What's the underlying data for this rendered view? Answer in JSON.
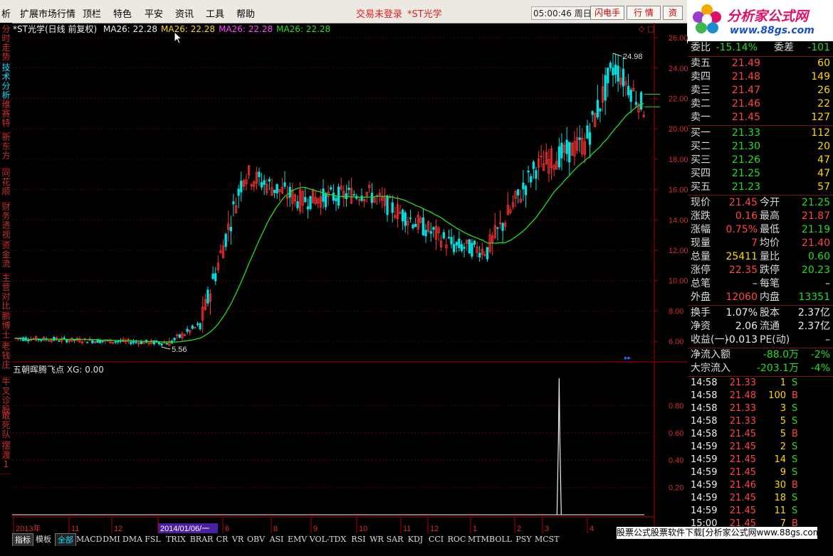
{
  "menu": {
    "items": [
      "析",
      "扩展市场行情",
      "顶栏",
      "特色",
      "平安",
      "资讯",
      "工具",
      "帮助"
    ],
    "login_status": "交易未登录",
    "stock_name": "*ST光学",
    "clock": "05:00:46 周日",
    "buttons": [
      "闪电手",
      "行 情",
      "资"
    ]
  },
  "logo": {
    "title": "分析家公式网",
    "url": "www.88gs.com"
  },
  "left_tabs": [
    {
      "label": "分时走势",
      "active": false
    },
    {
      "label": "技术分析",
      "active": true
    },
    {
      "label": "维赛特",
      "active": false
    },
    {
      "label": "新东方",
      "active": false
    },
    {
      "label": "同花顺",
      "active": false
    },
    {
      "label": "财务透视",
      "active": false
    },
    {
      "label": "资金流",
      "active": false
    },
    {
      "label": "主营对比",
      "active": false
    },
    {
      "label": "鹏博士",
      "active": false
    },
    {
      "label": "老钱庄",
      "active": false
    },
    {
      "label": "牛叉诊股",
      "active": false
    },
    {
      "label": "敢死队",
      "active": false
    },
    {
      "label": "摆渡1",
      "active": false
    }
  ],
  "chart_header": {
    "title": "*ST光学(日线 前复权)",
    "ma_items": [
      {
        "text": "MA26: 22.28",
        "color": "#eeeeee"
      },
      {
        "text": "MA26: 22.28",
        "color": "#ffd700"
      },
      {
        "text": "MA26: 22.28",
        "color": "#ff44ff"
      },
      {
        "text": "MA26: 22.28",
        "color": "#22dd22"
      }
    ]
  },
  "indicator_header": {
    "name": "五朝晖腾飞点",
    "value": "XG: 0.00"
  },
  "chart_data": [
    {
      "type": "candlestick",
      "title": "*ST光学(日线 前复权)",
      "y_ticks": [
        "26.00",
        "24.00",
        "22.00",
        "20.00",
        "18.00",
        "16.00",
        "14.00",
        "12.00",
        "10.00",
        "8.00",
        "6.00"
      ],
      "ylim": [
        4.6,
        26.8
      ],
      "annotations": [
        {
          "text": "24.98",
          "x": "high"
        },
        {
          "text": "5.56",
          "x": "low"
        }
      ],
      "phases": [
        {
          "bars": 60,
          "from": 6.2,
          "to": 5.9,
          "vol": 0.2
        },
        {
          "bars": 12,
          "from": 5.9,
          "to": 7.0,
          "vol": 0.3
        },
        {
          "bars": 18,
          "from": 7.0,
          "to": 17.0,
          "vol": 1.0
        },
        {
          "bars": 22,
          "from": 17.0,
          "to": 15.3,
          "vol": 0.9
        },
        {
          "bars": 25,
          "from": 15.3,
          "to": 15.8,
          "vol": 0.8
        },
        {
          "bars": 35,
          "from": 15.8,
          "to": 12.3,
          "vol": 0.8
        },
        {
          "bars": 12,
          "from": 12.3,
          "to": 12.0,
          "vol": 0.7
        },
        {
          "bars": 20,
          "from": 12.0,
          "to": 17.5,
          "vol": 1.0
        },
        {
          "bars": 18,
          "from": 17.5,
          "to": 19.0,
          "vol": 1.0
        },
        {
          "bars": 12,
          "from": 19.0,
          "to": 24.0,
          "vol": 1.2
        },
        {
          "bars": 12,
          "from": 24.0,
          "to": 21.4,
          "vol": 1.0
        }
      ],
      "ma_period": 26,
      "ma_last": 22.28,
      "last_close": 21.45
    },
    {
      "type": "bar",
      "title": "五朝晖腾飞点",
      "y_ticks": [
        "0.80",
        "0.60",
        "0.40",
        "0.20"
      ],
      "ylim": [
        0,
        1.0
      ],
      "signal": {
        "name": "XG",
        "value": 1.0,
        "bar_index": 212
      }
    }
  ],
  "x_axis": {
    "labels": [
      "2013年",
      "11",
      "12",
      "2014/01/06/一",
      "6",
      "8",
      "9",
      "10",
      "11",
      "12",
      "1",
      "2",
      "3",
      "4"
    ],
    "selected": "2014/01/06/一"
  },
  "quote": {
    "weibi": {
      "label": "委比",
      "value": "-15.14%",
      "label2": "委差",
      "value2": "-101"
    },
    "sell": [
      {
        "label": "卖五",
        "price": "21.49",
        "vol": "60"
      },
      {
        "label": "卖四",
        "price": "21.48",
        "vol": "149"
      },
      {
        "label": "卖三",
        "price": "21.47",
        "vol": "26"
      },
      {
        "label": "卖二",
        "price": "21.46",
        "vol": "22"
      },
      {
        "label": "卖一",
        "price": "21.45",
        "vol": "127"
      }
    ],
    "buy": [
      {
        "label": "买一",
        "price": "21.33",
        "vol": "112"
      },
      {
        "label": "买二",
        "price": "21.30",
        "vol": "20"
      },
      {
        "label": "买三",
        "price": "21.26",
        "vol": "47"
      },
      {
        "label": "买四",
        "price": "21.25",
        "vol": "47"
      },
      {
        "label": "买五",
        "price": "21.23",
        "vol": "57"
      }
    ],
    "stats": [
      {
        "l1": "现价",
        "v1": "21.45",
        "c1": "red",
        "l2": "今开",
        "v2": "21.25",
        "c2": "green"
      },
      {
        "l1": "涨跌",
        "v1": "0.16",
        "c1": "red",
        "l2": "最高",
        "v2": "21.87",
        "c2": "red"
      },
      {
        "l1": "涨幅",
        "v1": "0.75%",
        "c1": "red",
        "l2": "最低",
        "v2": "21.19",
        "c2": "green"
      },
      {
        "l1": "现量",
        "v1": "7",
        "c1": "red",
        "l2": "均价",
        "v2": "21.40",
        "c2": "red"
      },
      {
        "l1": "总量",
        "v1": "25411",
        "c1": "yellow",
        "l2": "量比",
        "v2": "0.60",
        "c2": "green"
      },
      {
        "l1": "涨停",
        "v1": "22.35",
        "c1": "red",
        "l2": "跌停",
        "v2": "20.23",
        "c2": "green"
      },
      {
        "l1": "总笔",
        "v1": "–",
        "c1": "white",
        "l2": "每笔",
        "v2": "–",
        "c2": "white"
      },
      {
        "l1": "外盘",
        "v1": "12060",
        "c1": "red",
        "l2": "内盘",
        "v2": "13351",
        "c2": "green"
      }
    ],
    "fin": [
      {
        "l1": "换手",
        "v1": "1.07%",
        "c1": "white",
        "l2": "股本",
        "v2": "2.37亿",
        "c2": "white"
      },
      {
        "l1": "净资",
        "v1": "2.06",
        "c1": "white",
        "l2": "流通",
        "v2": "2.37亿",
        "c2": "white"
      },
      {
        "l1": "收益(一)",
        "v1": "-0.013",
        "c1": "white",
        "l2": "PE(动)",
        "v2": "–",
        "c2": "white"
      }
    ],
    "flows": [
      {
        "label": "净流入额",
        "value": "-88.0万",
        "pct": "-2%"
      },
      {
        "label": "大宗流入",
        "value": "-203.1万",
        "pct": "-4%"
      }
    ],
    "ticks": [
      {
        "time": "14:58",
        "price": "21.33",
        "vol": "1",
        "bs": "S"
      },
      {
        "time": "14:58",
        "price": "21.48",
        "vol": "100",
        "bs": "B"
      },
      {
        "time": "14:58",
        "price": "21.33",
        "vol": "3",
        "bs": "S"
      },
      {
        "time": "14:58",
        "price": "21.33",
        "vol": "5",
        "bs": "S"
      },
      {
        "time": "14:58",
        "price": "21.45",
        "vol": "5",
        "bs": "B"
      },
      {
        "time": "14:59",
        "price": "21.45",
        "vol": "2",
        "bs": "S"
      },
      {
        "time": "14:59",
        "price": "21.45",
        "vol": "14",
        "bs": "S"
      },
      {
        "time": "14:59",
        "price": "21.45",
        "vol": "9",
        "bs": "S"
      },
      {
        "time": "14:59",
        "price": "21.46",
        "vol": "30",
        "bs": "B"
      },
      {
        "time": "14:59",
        "price": "21.45",
        "vol": "18",
        "bs": "S"
      },
      {
        "time": "14:59",
        "price": "21.45",
        "vol": "11",
        "bs": "S"
      },
      {
        "time": "15:00",
        "price": "21.45",
        "vol": "7",
        "bs": "B"
      }
    ]
  },
  "indicator_tabs": [
    "指标",
    "模板",
    "全部",
    "MACD",
    "DMI",
    "DMA",
    "FSL",
    "TRIX",
    "BRAR",
    "CR",
    "VR",
    "OBV",
    "ASI",
    "EMV",
    "VOL-TDX",
    "RSI",
    "WR",
    "SAR",
    "KDJ",
    "CCI",
    "ROC",
    "MTM",
    "BOLL",
    "PSY",
    "MCST"
  ],
  "banner": "股票公式股票软件下载[分析家公式网www.88gs.com]",
  "colors": {
    "up": "#ff3333",
    "down": "#00e0e0",
    "ma": "#22dd22",
    "grid": "#5a0000",
    "axis": "#b00000"
  }
}
